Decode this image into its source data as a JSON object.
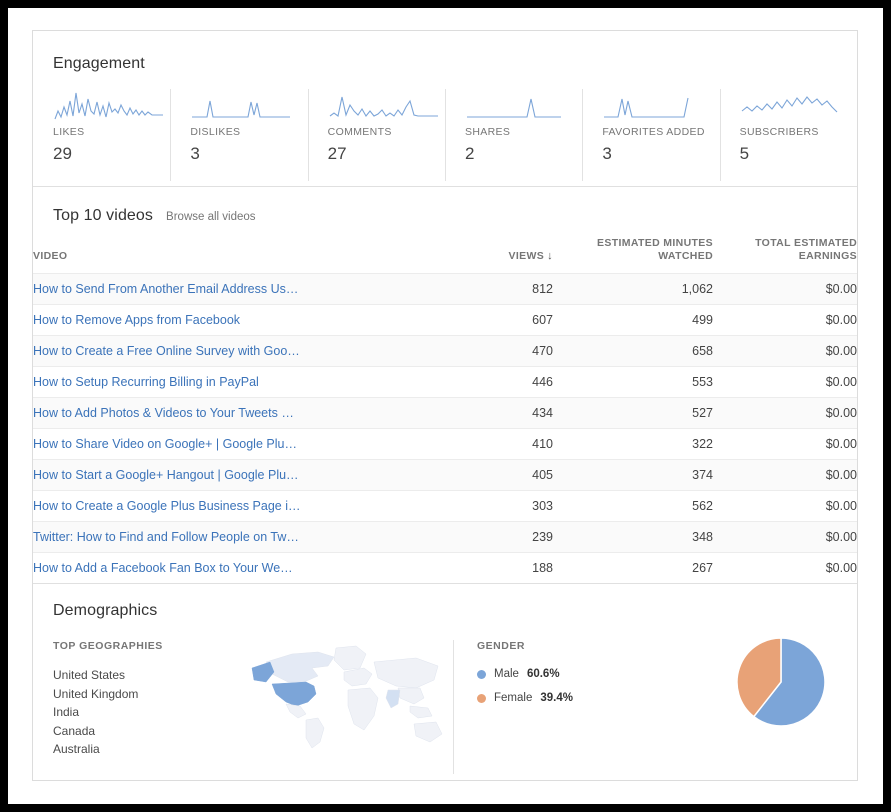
{
  "colors": {
    "blue": "#7ca5d8",
    "orange": "#e8a277",
    "link": "#3b73b9",
    "spark": "#7ca5d8"
  },
  "engagement": {
    "title": "Engagement",
    "metrics": [
      {
        "label": "LIKES",
        "value": "29",
        "icon": "sparkline-icon"
      },
      {
        "label": "DISLIKES",
        "value": "3",
        "icon": "sparkline-icon"
      },
      {
        "label": "COMMENTS",
        "value": "27",
        "icon": "sparkline-icon"
      },
      {
        "label": "SHARES",
        "value": "2",
        "icon": "sparkline-icon"
      },
      {
        "label": "FAVORITES ADDED",
        "value": "3",
        "icon": "sparkline-icon"
      },
      {
        "label": "SUBSCRIBERS",
        "value": "5",
        "icon": "sparkline-icon"
      }
    ]
  },
  "top_videos": {
    "title": "Top 10 videos",
    "browse_link": "Browse all videos",
    "columns": {
      "video": "VIDEO",
      "views": "VIEWS",
      "views_sort_icon": "sort-descending-arrow-icon",
      "minutes": "ESTIMATED MINUTES WATCHED",
      "earnings": "TOTAL ESTIMATED EARNINGS"
    },
    "rows": [
      {
        "title": "How to Send From Another Email Address Us…",
        "views": "812",
        "minutes": "1,062",
        "earnings": "$0.00"
      },
      {
        "title": "How to Remove Apps from Facebook",
        "views": "607",
        "minutes": "499",
        "earnings": "$0.00"
      },
      {
        "title": "How to Create a Free Online Survey with Goo…",
        "views": "470",
        "minutes": "658",
        "earnings": "$0.00"
      },
      {
        "title": "How to Setup Recurring Billing in PayPal",
        "views": "446",
        "minutes": "553",
        "earnings": "$0.00"
      },
      {
        "title": "How to Add Photos & Videos to Your Tweets …",
        "views": "434",
        "minutes": "527",
        "earnings": "$0.00"
      },
      {
        "title": "How to Share Video on Google+ | Google Plu…",
        "views": "410",
        "minutes": "322",
        "earnings": "$0.00"
      },
      {
        "title": "How to Start a Google+ Hangout | Google Plu…",
        "views": "405",
        "minutes": "374",
        "earnings": "$0.00"
      },
      {
        "title": "How to Create a Google Plus Business Page i…",
        "views": "303",
        "minutes": "562",
        "earnings": "$0.00"
      },
      {
        "title": "Twitter: How to Find and Follow People on Tw…",
        "views": "239",
        "minutes": "348",
        "earnings": "$0.00"
      },
      {
        "title": "How to Add a Facebook Fan Box to Your We…",
        "views": "188",
        "minutes": "267",
        "earnings": "$0.00"
      }
    ]
  },
  "demographics": {
    "title": "Demographics",
    "geographies_label": "TOP GEOGRAPHIES",
    "geographies": [
      "United States",
      "United Kingdom",
      "India",
      "Canada",
      "Australia"
    ],
    "map_icon": "world-map-icon",
    "gender_label": "GENDER",
    "gender": [
      {
        "name": "Male",
        "pct": "60.6%",
        "value": 60.6,
        "color": "#7ca5d8"
      },
      {
        "name": "Female",
        "pct": "39.4%",
        "value": 39.4,
        "color": "#e8a277"
      }
    ]
  },
  "chart_data": [
    {
      "type": "line",
      "title": "LIKES",
      "values": [
        3,
        6,
        2,
        7,
        4,
        9,
        3,
        12,
        5,
        8,
        4,
        10,
        6,
        5,
        9,
        4,
        7,
        3,
        8,
        5,
        6,
        4,
        7,
        5,
        3,
        6,
        4,
        5,
        3,
        4
      ],
      "total": 29
    },
    {
      "type": "line",
      "title": "DISLIKES",
      "values": [
        0,
        0,
        0,
        0,
        6,
        0,
        0,
        0,
        0,
        0,
        0,
        0,
        0,
        0,
        0,
        7,
        0,
        6,
        0,
        0,
        0,
        0,
        0,
        0,
        0,
        0,
        0,
        0,
        0,
        0
      ],
      "total": 3
    },
    {
      "type": "line",
      "title": "COMMENTS",
      "values": [
        1,
        2,
        10,
        4,
        8,
        3,
        5,
        2,
        4,
        2,
        6,
        3,
        2,
        5,
        3,
        2,
        4,
        3,
        6,
        3,
        2,
        5,
        9,
        4,
        2,
        1,
        1,
        1,
        1,
        1
      ],
      "total": 27
    },
    {
      "type": "line",
      "title": "SHARES",
      "values": [
        0,
        0,
        0,
        0,
        0,
        0,
        0,
        0,
        0,
        0,
        0,
        0,
        0,
        0,
        0,
        0,
        0,
        0,
        0,
        0,
        0,
        0,
        9,
        0,
        0,
        0,
        0,
        0,
        0,
        0
      ],
      "total": 2
    },
    {
      "type": "line",
      "title": "FAVORITES ADDED",
      "values": [
        0,
        0,
        0,
        0,
        8,
        0,
        0,
        0,
        0,
        0,
        0,
        0,
        0,
        0,
        0,
        0,
        0,
        0,
        0,
        0,
        0,
        0,
        0,
        0,
        0,
        0,
        0,
        9,
        0,
        0
      ],
      "total": 3
    },
    {
      "type": "line",
      "title": "SUBSCRIBERS",
      "values": [
        3,
        2,
        4,
        3,
        2,
        4,
        3,
        5,
        3,
        6,
        4,
        5,
        7,
        4,
        6,
        8,
        5,
        7,
        6,
        8,
        7,
        9,
        6,
        7,
        5,
        6,
        4,
        5,
        3,
        2
      ],
      "total": 5
    },
    {
      "type": "pie",
      "title": "GENDER",
      "categories": [
        "Male",
        "Female"
      ],
      "values": [
        60.6,
        39.4
      ],
      "colors": [
        "#7ca5d8",
        "#e8a277"
      ],
      "legend": "left"
    }
  ]
}
